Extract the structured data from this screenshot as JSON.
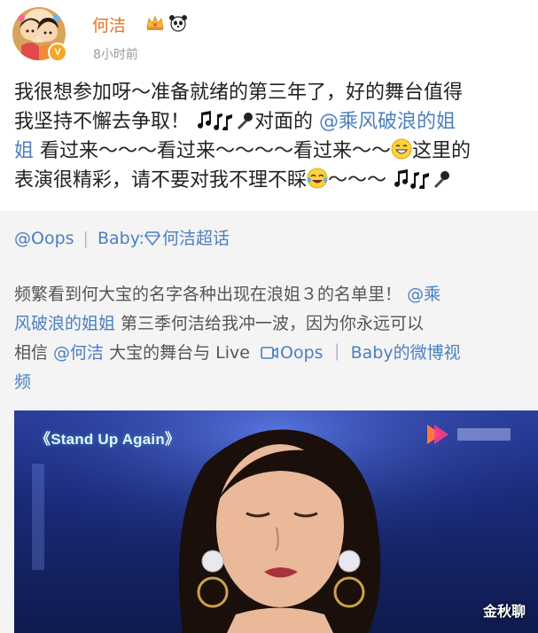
{
  "header": {
    "username": "何洁",
    "timestamp": "8小时前",
    "verified_icon": "v-badge-icon",
    "badges": [
      "crown-icon",
      "panda-icon"
    ]
  },
  "post": {
    "line1": "我很想参加呀～准备就绪的第三年了，好的舞台值得",
    "line2_a": "我坚持不懈去争取！",
    "line2_mention": "@乘风破浪的姐",
    "line3_mention": "姐",
    "line3_b": " 看过来～～～看过来～～～～看过来～～",
    "line3_c": "这里的",
    "line4_a": "表演很精彩，请不要对我不理不睬",
    "line4_b": "～～～",
    "line2_mid": "对面的 ",
    "emoji": [
      "music-note-icon",
      "microphone-icon",
      "grin-icon",
      "laugh-tears-icon"
    ]
  },
  "repost": {
    "head_user": "@Oops",
    "head_sep": "|",
    "head_baby": "Baby:",
    "head_topic": "何洁超话",
    "text1_a": "频繁看到何大宝的名字各种出现在浪姐３的名单里！",
    "text1_mention": "@乘",
    "text2_mention": "风破浪的姐姐",
    "text2_b": " 第三季何洁给我冲一波，因为你永远可以",
    "text3_a": "相信 ",
    "text3_mention": "@何洁",
    "text3_b": " 大宝的舞台与 Live ",
    "text3_link": "Oops ｜ Baby的微博视",
    "text4_link": "频"
  },
  "video": {
    "title": "《Stand Up Again》",
    "watermark": "金秋聊"
  },
  "colors": {
    "username": "#e8742a",
    "link": "#4a7fc0",
    "repost_bg": "#f4f4f4"
  }
}
